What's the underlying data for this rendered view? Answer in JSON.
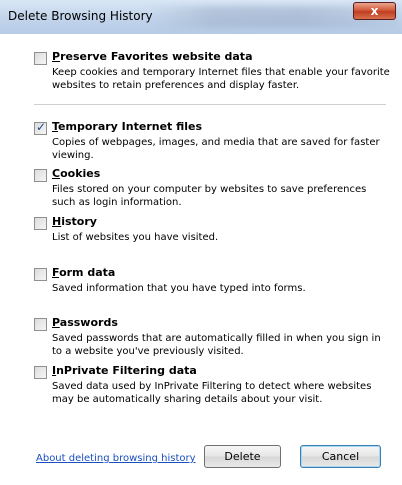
{
  "window": {
    "title": "Delete Browsing History",
    "close_label": "x"
  },
  "options": [
    {
      "label": "Preserve Favorites website data",
      "description": "Keep cookies and temporary Internet files that enable your favorite websites to retain preferences and display faster.",
      "checked": false
    },
    {
      "label": "Temporary Internet files",
      "description": "Copies of webpages, images, and media that are saved for faster viewing.",
      "checked": true
    },
    {
      "label": "Cookies",
      "description": "Files stored on your computer by websites to save preferences such as login information.",
      "checked": false
    },
    {
      "label": "History",
      "description": "List of websites you have visited.",
      "checked": false
    },
    {
      "label": "Form data",
      "description": "Saved information that you have typed into forms.",
      "checked": false
    },
    {
      "label": "Passwords",
      "description": "Saved passwords that are automatically filled in when you sign in to a website you've previously visited.",
      "checked": false
    },
    {
      "label": "InPrivate Filtering data",
      "description": "Saved data used by InPrivate Filtering to detect where websites may be automatically sharing details about your visit.",
      "checked": false
    }
  ],
  "footer": {
    "link_text": "About deleting browsing history",
    "delete_label": "Delete",
    "cancel_label": "Cancel"
  },
  "checkmark_glyph": "✓",
  "colors": {
    "link": "#1a4fbf",
    "checkmark": "#1c4a8a",
    "close_button": "#c13e22"
  }
}
